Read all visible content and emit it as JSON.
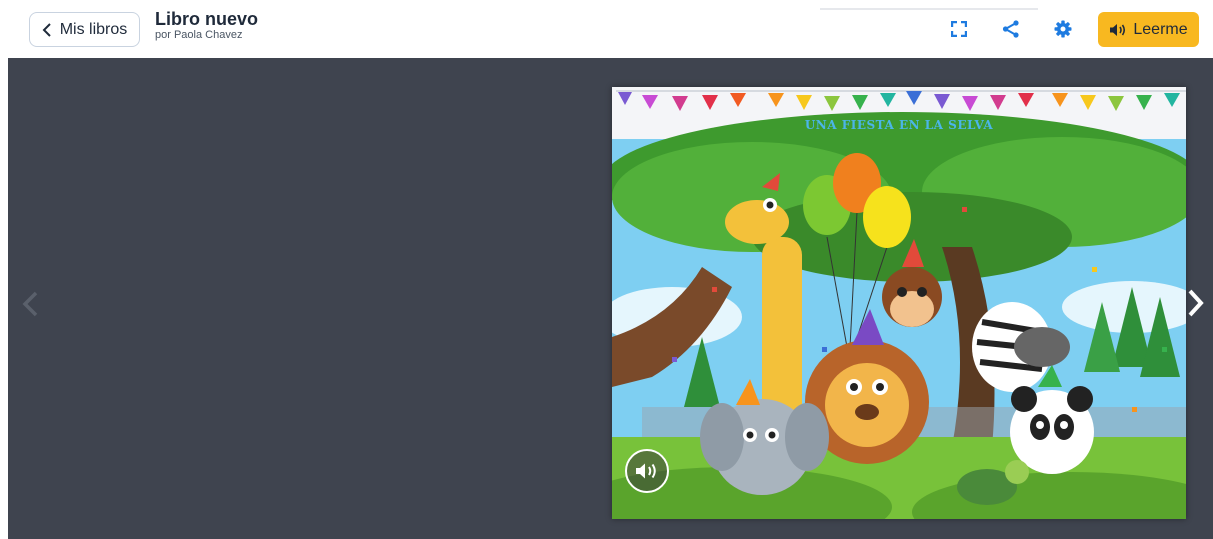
{
  "header": {
    "back_label": "Mis libros",
    "title": "Libro nuevo",
    "author": "por Paola Chavez",
    "read_label": "Leerme"
  },
  "icons": {
    "back": "chevron-left-icon",
    "fullscreen": "fullscreen-icon",
    "share": "share-icon",
    "settings": "gear-icon",
    "speaker": "speaker-icon",
    "prev": "chevron-left-icon",
    "next": "chevron-right-icon"
  },
  "book": {
    "cover_title": "UNA FIESTA EN LA SELVA"
  },
  "colors": {
    "accent": "#f8b820",
    "toolbar_icon": "#1e7be0",
    "stage": "#3f444f"
  }
}
